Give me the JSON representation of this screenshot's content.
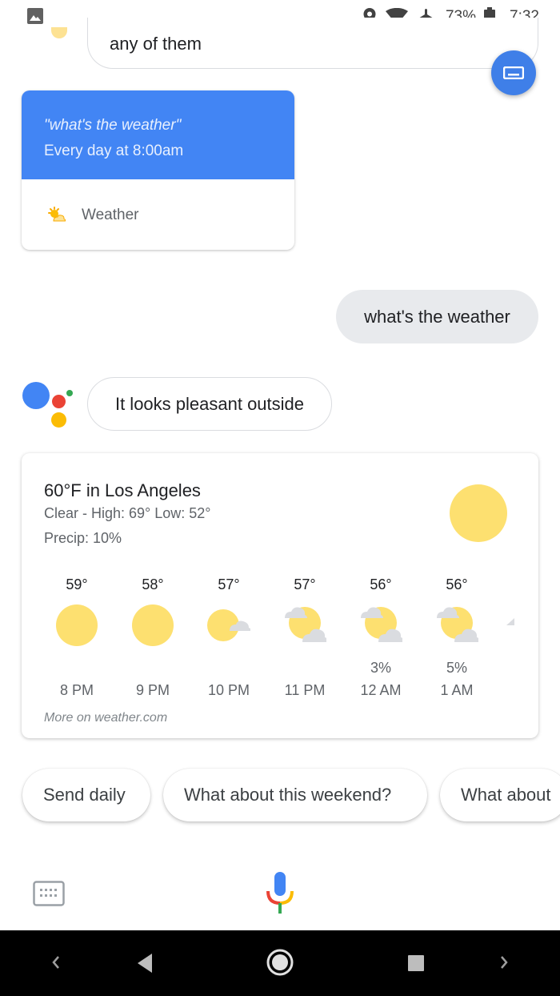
{
  "status_bar": {
    "battery_percent": "73%",
    "time": "7:32",
    "icons": [
      "image-icon",
      "location-icon",
      "wifi-icon",
      "airplane-icon",
      "battery-icon"
    ]
  },
  "conversation": {
    "previous_user_message": "any of them",
    "routine_card": {
      "query": "\"what's the weather\"",
      "schedule": "Every day at 8:00am",
      "item_label": "Weather"
    },
    "user_query": "what's the weather",
    "assistant_reply": "It looks pleasant outside"
  },
  "weather": {
    "headline": "60°F in Los Angeles",
    "summary": "Clear - High: 69° Low: 52°",
    "precip": "Precip: 10%",
    "condition_icon": "sun",
    "hourly": [
      {
        "temp": "59°",
        "icon": "sun",
        "precip": "",
        "time": "8 PM"
      },
      {
        "temp": "58°",
        "icon": "sun",
        "precip": "",
        "time": "9 PM"
      },
      {
        "temp": "57°",
        "icon": "partly-cloudy",
        "precip": "",
        "time": "10 PM"
      },
      {
        "temp": "57°",
        "icon": "cloudy-sun",
        "precip": "",
        "time": "11 PM"
      },
      {
        "temp": "56°",
        "icon": "cloudy-sun",
        "precip": "3%",
        "time": "12 AM"
      },
      {
        "temp": "56°",
        "icon": "cloudy-sun",
        "precip": "5%",
        "time": "1 AM"
      }
    ],
    "source_link": "More on weather.com"
  },
  "suggestions": [
    "Send daily",
    "What about this weekend?",
    "What about"
  ],
  "input_bar": {
    "keyboard": "keyboard-icon",
    "mic": "mic-icon"
  },
  "colors": {
    "accent_blue": "#4285f4",
    "sun_yellow": "#fde070",
    "cloud_gray": "#dadce0"
  }
}
